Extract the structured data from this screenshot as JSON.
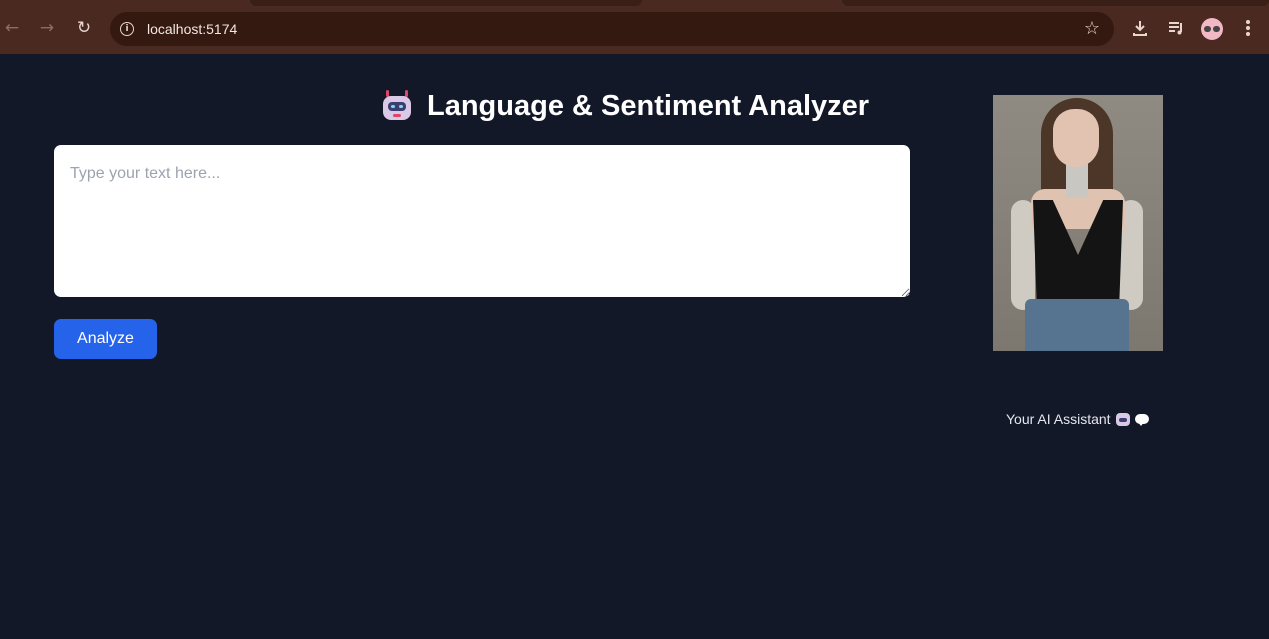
{
  "browser": {
    "url": "localhost:5174",
    "back_icon": "arrow-left-icon",
    "forward_icon": "arrow-right-icon",
    "reload_icon": "reload-icon",
    "site_info_icon": "info-icon",
    "bookmark_icon": "star-icon",
    "download_icon": "download-icon",
    "media_icon": "playlist-icon",
    "profile_icon": "avatar-icon",
    "menu_icon": "kebab-menu-icon",
    "colors": {
      "toolbar": "#4a2a20",
      "omnibox": "#33190f"
    }
  },
  "main": {
    "title_icon": "robot-icon",
    "title": "Language & Sentiment Analyzer",
    "input_placeholder": "Type your text here...",
    "input_value": "",
    "analyze_label": "Analyze",
    "colors": {
      "background": "#121828",
      "button": "#2563eb"
    }
  },
  "assistant": {
    "image_icon": "assistant-portrait",
    "caption": "Your AI Assistant",
    "caption_icons": [
      "robot-icon",
      "speech-bubble-icon"
    ]
  }
}
